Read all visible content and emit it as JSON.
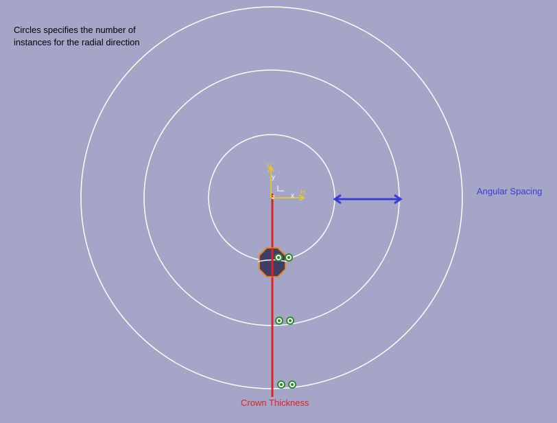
{
  "annotations": {
    "circles_note": "Circles specifies the number of instances for the radial direction",
    "angular_spacing": "Angular Spacing",
    "crown_thickness": "Crown Thickness"
  },
  "axis": {
    "y_label": "y",
    "x_label": "x",
    "h_label": "H",
    "v_label": "V",
    "z_label": "z"
  },
  "colors": {
    "background": "#a5a5c8",
    "circle_stroke": "#ffffff",
    "angular_arrow": "#3b3bd6",
    "crown_line": "#e02020",
    "axis": "#f0d000",
    "instance_marker": "#2a8a2a",
    "seed_body": "#3e3e66",
    "seed_outline": "#f08010"
  },
  "pattern": {
    "radial_instance_count": 3,
    "instances_per_ring": 2
  }
}
